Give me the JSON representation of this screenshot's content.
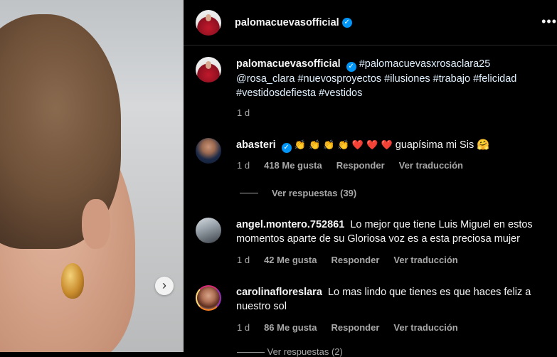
{
  "photo": {
    "next_icon": "chevron-right-icon",
    "next_symbol": "›"
  },
  "header": {
    "username": "palomacuevasofficial",
    "verified_icon": "verified-badge-icon",
    "verified_symbol": "✓",
    "more_symbol": "•••"
  },
  "caption": {
    "username": "palomacuevasofficial",
    "text": "#palomacuevasxrosaclara25 @rosa_clara #nuevosproyectos #ilusiones #trabajo #felicidad #vestidosdefiesta #vestidos",
    "time": "1 d"
  },
  "comments": [
    {
      "username": "abasteri",
      "emojis": "👏 👏 👏 👏 ❤️ ❤️ ❤️",
      "text": "guapísima mi Sis 🤗",
      "time": "1 d",
      "likes": "418 Me gusta",
      "reply": "Responder",
      "translate": "Ver traducción",
      "view_replies": "Ver respuestas (39)"
    },
    {
      "username": "angel.montero.752861",
      "text": "Lo mejor que tiene Luis Miguel en estos momentos aparte de su Gloriosa voz es a esta preciosa mujer",
      "time": "1 d",
      "likes": "42 Me gusta",
      "reply": "Responder",
      "translate": "Ver traducción"
    },
    {
      "username": "carolinafloreslara",
      "text": "Lo mas lindo que tienes es que haces feliz a nuestro sol",
      "time": "1 d",
      "likes": "86 Me gusta",
      "reply": "Responder",
      "translate": "Ver traducción"
    }
  ],
  "next_partial": "———     Ver respuestas (2)"
}
